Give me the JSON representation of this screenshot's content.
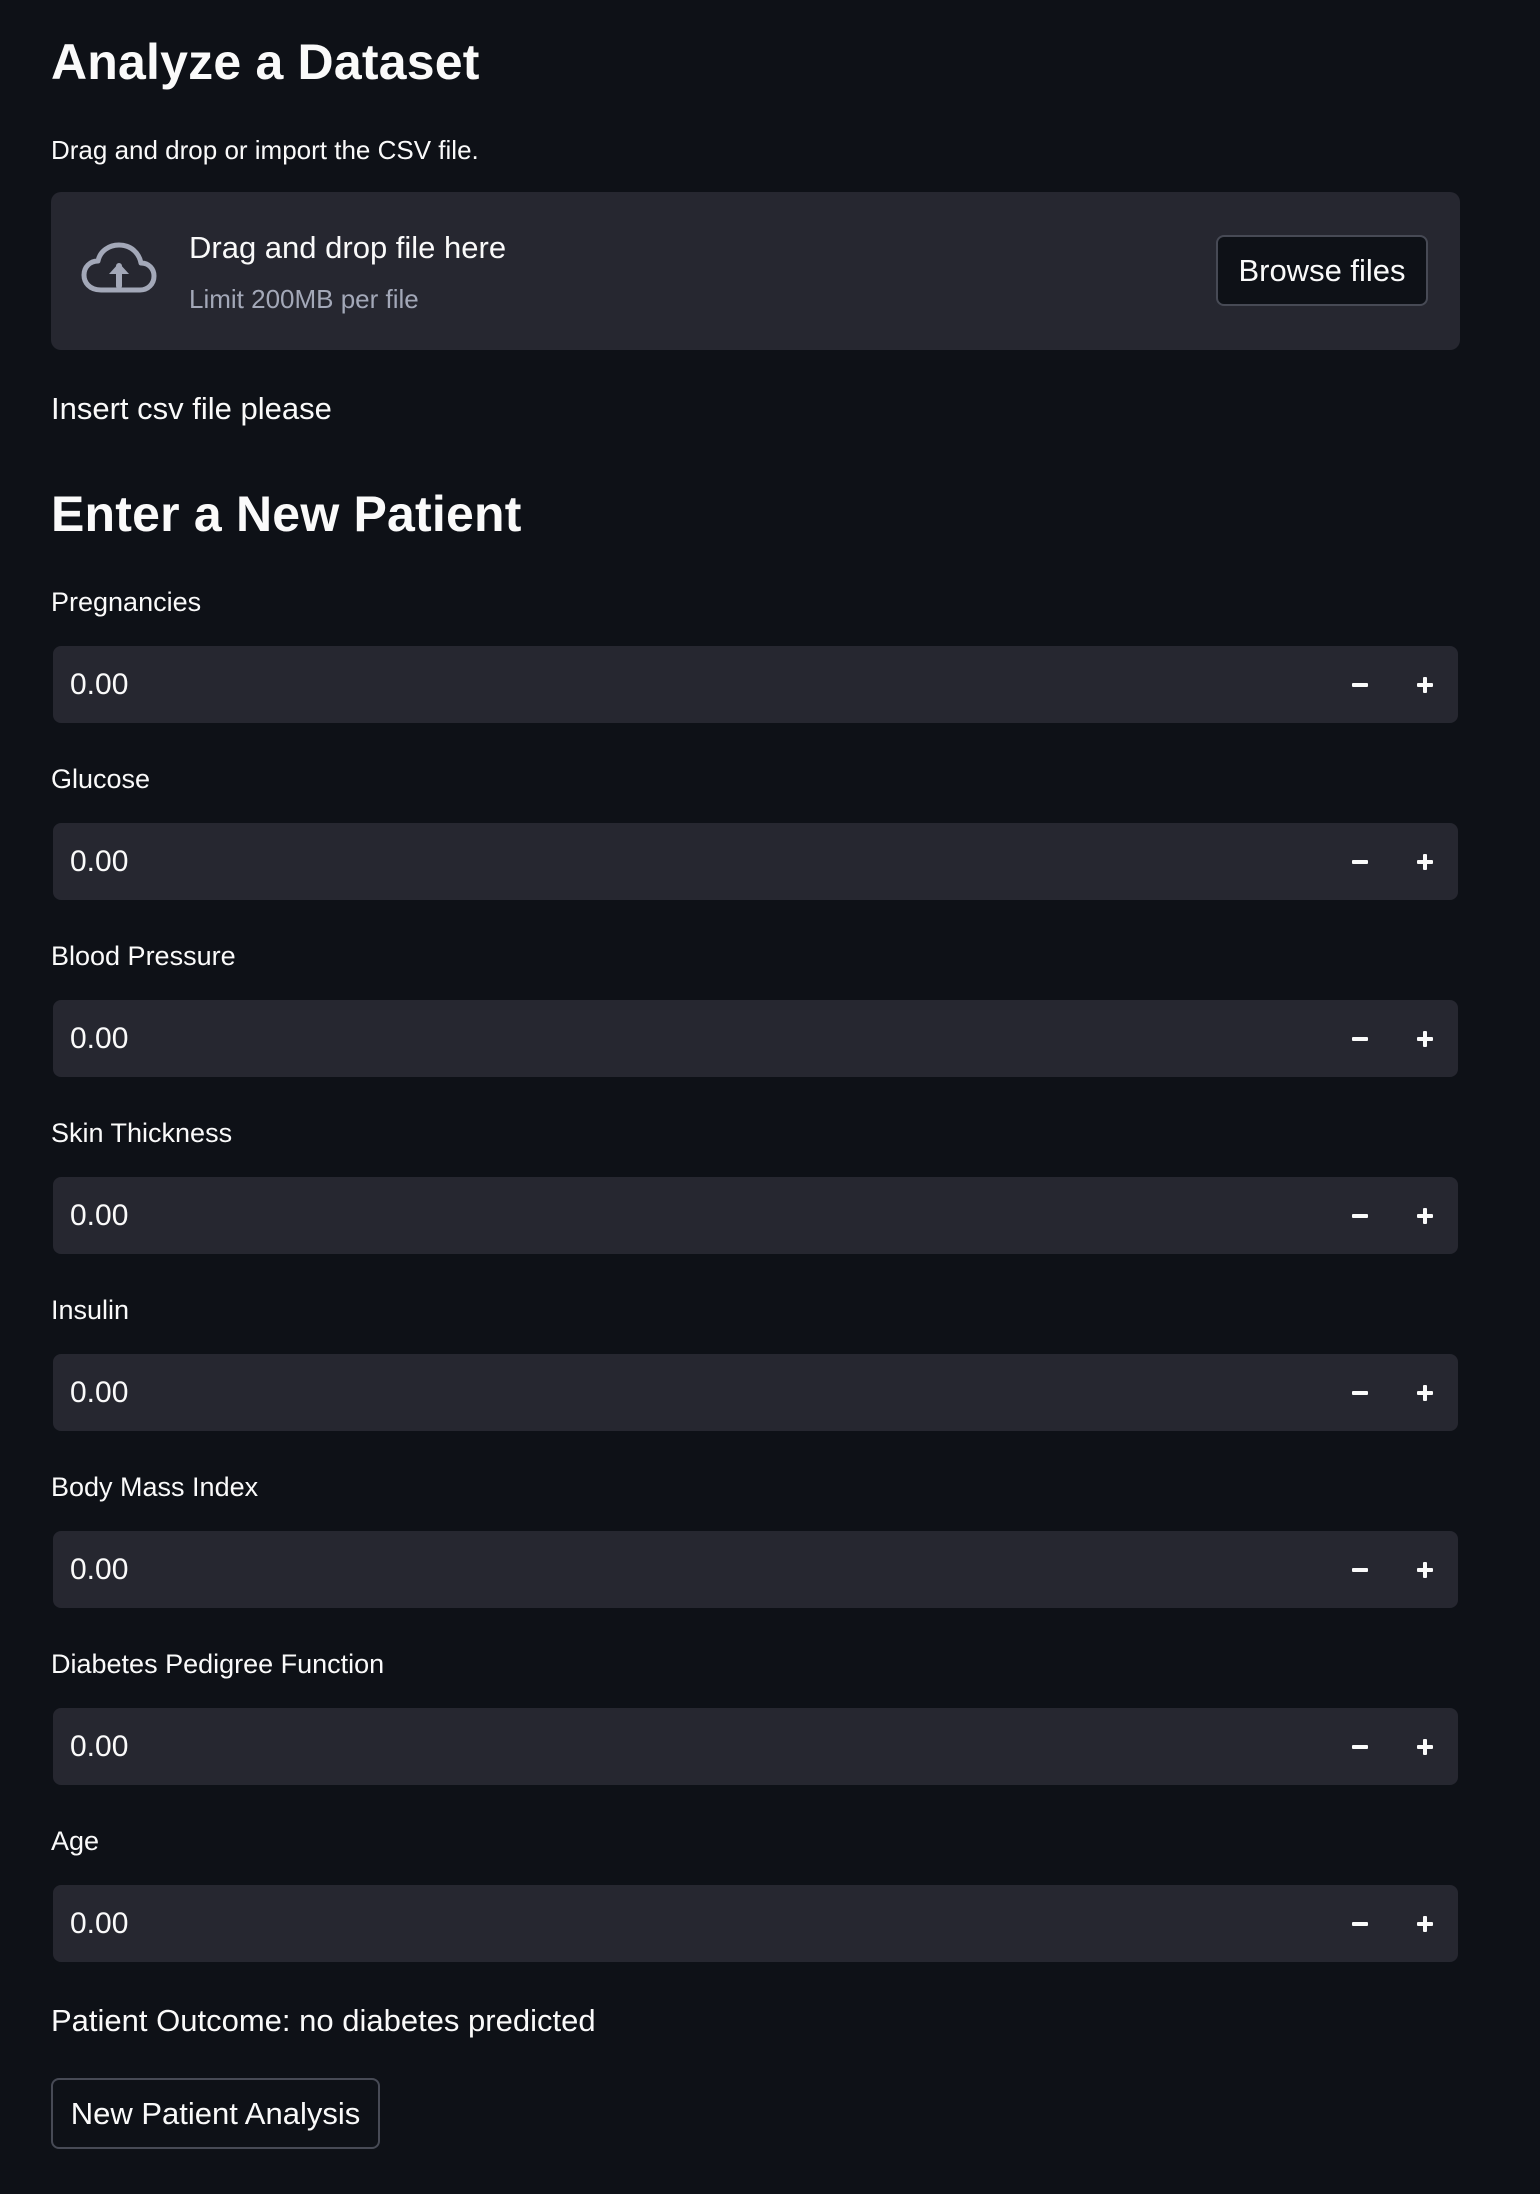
{
  "analyze": {
    "title": "Analyze a Dataset",
    "caption": "Drag and drop or import the CSV file.",
    "uploader": {
      "drop_text": "Drag and drop file here",
      "limit_text": "Limit 200MB per file",
      "browse_label": "Browse files",
      "icon": "cloud-upload-icon"
    },
    "message": "Insert csv file please"
  },
  "patient": {
    "title": "Enter a New Patient",
    "fields": [
      {
        "label": "Pregnancies",
        "value": "0.00"
      },
      {
        "label": "Glucose",
        "value": "0.00"
      },
      {
        "label": "Blood Pressure",
        "value": "0.00"
      },
      {
        "label": "Skin Thickness",
        "value": "0.00"
      },
      {
        "label": "Insulin",
        "value": "0.00"
      },
      {
        "label": "Body Mass Index",
        "value": "0.00"
      },
      {
        "label": "Diabetes Pedigree Function",
        "value": "0.00"
      },
      {
        "label": "Age",
        "value": "0.00"
      }
    ],
    "outcome": "Patient Outcome: no diabetes predicted",
    "analysis_button": "New Patient Analysis"
  },
  "colors": {
    "background": "#0e1117",
    "widget": "#262730",
    "text": "#fafafa",
    "muted": "#a3a8b8",
    "border": "#474a55"
  }
}
